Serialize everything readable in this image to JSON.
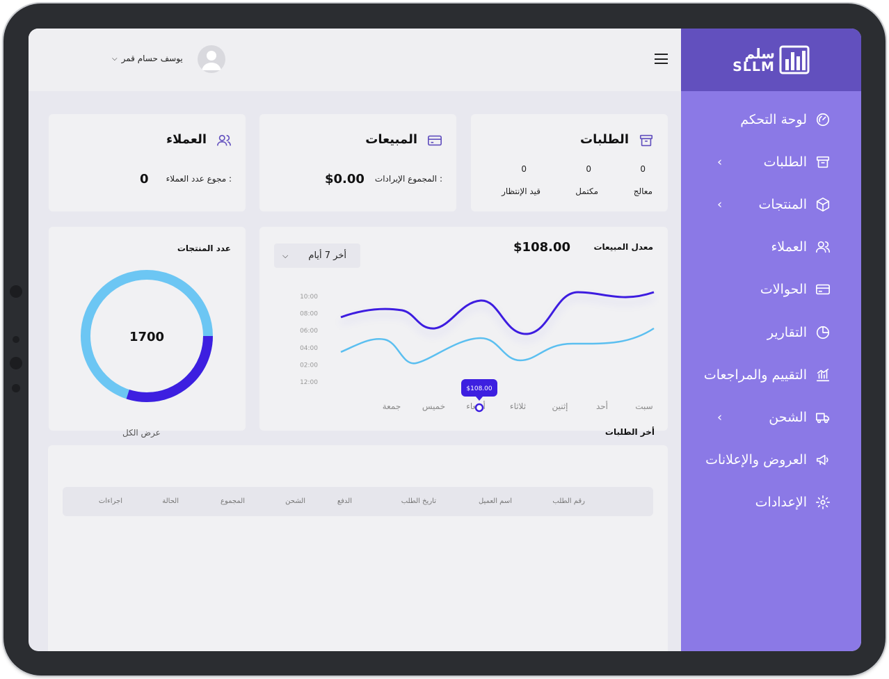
{
  "brand": {
    "name_ar": "سلم",
    "name_en": "SLLM",
    "accent": "#6250be",
    "sidebar_bg": "#8b79e6"
  },
  "header": {
    "user_name": "يوسف حسام قمر"
  },
  "sidebar": {
    "items": [
      {
        "label": "لوحة التحكم",
        "icon": "gauge-icon",
        "chevron": false
      },
      {
        "label": "الطلبات",
        "icon": "archive-box-icon",
        "chevron": true
      },
      {
        "label": "المنتجات",
        "icon": "cube-icon",
        "chevron": true
      },
      {
        "label": "العملاء",
        "icon": "users-icon",
        "chevron": false
      },
      {
        "label": "الحوالات",
        "icon": "credit-card-icon",
        "chevron": false
      },
      {
        "label": "التقارير",
        "icon": "pie-chart-icon",
        "chevron": false
      },
      {
        "label": "التقييم والمراجعات",
        "icon": "bar-chart-icon",
        "chevron": false
      },
      {
        "label": "الشحن",
        "icon": "truck-icon",
        "chevron": true
      },
      {
        "label": "العروض والإعلانات",
        "icon": "megaphone-icon",
        "chevron": false
      },
      {
        "label": "الإعدادات",
        "icon": "gear-icon",
        "chevron": false
      }
    ]
  },
  "orders_card": {
    "title": "الطلبات",
    "stats": [
      {
        "label": "معالج",
        "value": "0"
      },
      {
        "label": "مكتمل",
        "value": "0"
      },
      {
        "label": "قيد الإنتظار",
        "value": "0"
      }
    ]
  },
  "sales_card": {
    "title": "المبيعات",
    "label": "المجموع الإيرادات :",
    "value": "$0.00"
  },
  "customers_card": {
    "title": "العملاء",
    "label": "مجوع عدد العملاء :",
    "value": "0"
  },
  "sales_rate": {
    "title": "معدل المبيعات",
    "value": "$108.00",
    "range_select": "أخر 7 أيام",
    "tooltip": "$108.00",
    "y_ticks": [
      "10:00",
      "08:00",
      "06:00",
      "04:00",
      "02:00",
      "12:00"
    ],
    "days": [
      "سبت",
      "أحد",
      "إثنين",
      "ثلاثاء",
      "أربعاء",
      "خميس",
      "جمعة"
    ],
    "colors": {
      "primary": "#3d1fe0",
      "secondary": "#5bbff0"
    }
  },
  "products_count": {
    "title": "عدد المنتجات",
    "total": "1700",
    "fraction_primary": 0.3,
    "colors": {
      "primary": "#3d1fe0",
      "secondary": "#6cc6f3"
    }
  },
  "view_all": "عرض الكل",
  "latest_orders": {
    "title": "أخر الطلبات",
    "columns": [
      "رقم الطلب",
      "اسم العميل",
      "تاريخ الطلب",
      "الدفع",
      "الشحن",
      "المجموع",
      "الحالة",
      "اجراءات"
    ]
  }
}
